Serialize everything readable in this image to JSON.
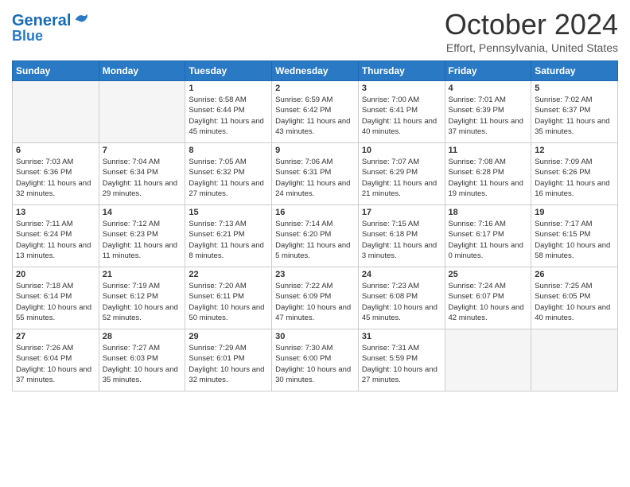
{
  "header": {
    "logo_line1": "General",
    "logo_line2": "Blue",
    "month": "October 2024",
    "location": "Effort, Pennsylvania, United States"
  },
  "days_of_week": [
    "Sunday",
    "Monday",
    "Tuesday",
    "Wednesday",
    "Thursday",
    "Friday",
    "Saturday"
  ],
  "weeks": [
    [
      {
        "day": "",
        "info": "",
        "empty": true
      },
      {
        "day": "",
        "info": "",
        "empty": true
      },
      {
        "day": "1",
        "info": "Sunrise: 6:58 AM\nSunset: 6:44 PM\nDaylight: 11 hours and 45 minutes."
      },
      {
        "day": "2",
        "info": "Sunrise: 6:59 AM\nSunset: 6:42 PM\nDaylight: 11 hours and 43 minutes."
      },
      {
        "day": "3",
        "info": "Sunrise: 7:00 AM\nSunset: 6:41 PM\nDaylight: 11 hours and 40 minutes."
      },
      {
        "day": "4",
        "info": "Sunrise: 7:01 AM\nSunset: 6:39 PM\nDaylight: 11 hours and 37 minutes."
      },
      {
        "day": "5",
        "info": "Sunrise: 7:02 AM\nSunset: 6:37 PM\nDaylight: 11 hours and 35 minutes."
      }
    ],
    [
      {
        "day": "6",
        "info": "Sunrise: 7:03 AM\nSunset: 6:36 PM\nDaylight: 11 hours and 32 minutes."
      },
      {
        "day": "7",
        "info": "Sunrise: 7:04 AM\nSunset: 6:34 PM\nDaylight: 11 hours and 29 minutes."
      },
      {
        "day": "8",
        "info": "Sunrise: 7:05 AM\nSunset: 6:32 PM\nDaylight: 11 hours and 27 minutes."
      },
      {
        "day": "9",
        "info": "Sunrise: 7:06 AM\nSunset: 6:31 PM\nDaylight: 11 hours and 24 minutes."
      },
      {
        "day": "10",
        "info": "Sunrise: 7:07 AM\nSunset: 6:29 PM\nDaylight: 11 hours and 21 minutes."
      },
      {
        "day": "11",
        "info": "Sunrise: 7:08 AM\nSunset: 6:28 PM\nDaylight: 11 hours and 19 minutes."
      },
      {
        "day": "12",
        "info": "Sunrise: 7:09 AM\nSunset: 6:26 PM\nDaylight: 11 hours and 16 minutes."
      }
    ],
    [
      {
        "day": "13",
        "info": "Sunrise: 7:11 AM\nSunset: 6:24 PM\nDaylight: 11 hours and 13 minutes."
      },
      {
        "day": "14",
        "info": "Sunrise: 7:12 AM\nSunset: 6:23 PM\nDaylight: 11 hours and 11 minutes."
      },
      {
        "day": "15",
        "info": "Sunrise: 7:13 AM\nSunset: 6:21 PM\nDaylight: 11 hours and 8 minutes."
      },
      {
        "day": "16",
        "info": "Sunrise: 7:14 AM\nSunset: 6:20 PM\nDaylight: 11 hours and 5 minutes."
      },
      {
        "day": "17",
        "info": "Sunrise: 7:15 AM\nSunset: 6:18 PM\nDaylight: 11 hours and 3 minutes."
      },
      {
        "day": "18",
        "info": "Sunrise: 7:16 AM\nSunset: 6:17 PM\nDaylight: 11 hours and 0 minutes."
      },
      {
        "day": "19",
        "info": "Sunrise: 7:17 AM\nSunset: 6:15 PM\nDaylight: 10 hours and 58 minutes."
      }
    ],
    [
      {
        "day": "20",
        "info": "Sunrise: 7:18 AM\nSunset: 6:14 PM\nDaylight: 10 hours and 55 minutes."
      },
      {
        "day": "21",
        "info": "Sunrise: 7:19 AM\nSunset: 6:12 PM\nDaylight: 10 hours and 52 minutes."
      },
      {
        "day": "22",
        "info": "Sunrise: 7:20 AM\nSunset: 6:11 PM\nDaylight: 10 hours and 50 minutes."
      },
      {
        "day": "23",
        "info": "Sunrise: 7:22 AM\nSunset: 6:09 PM\nDaylight: 10 hours and 47 minutes."
      },
      {
        "day": "24",
        "info": "Sunrise: 7:23 AM\nSunset: 6:08 PM\nDaylight: 10 hours and 45 minutes."
      },
      {
        "day": "25",
        "info": "Sunrise: 7:24 AM\nSunset: 6:07 PM\nDaylight: 10 hours and 42 minutes."
      },
      {
        "day": "26",
        "info": "Sunrise: 7:25 AM\nSunset: 6:05 PM\nDaylight: 10 hours and 40 minutes."
      }
    ],
    [
      {
        "day": "27",
        "info": "Sunrise: 7:26 AM\nSunset: 6:04 PM\nDaylight: 10 hours and 37 minutes."
      },
      {
        "day": "28",
        "info": "Sunrise: 7:27 AM\nSunset: 6:03 PM\nDaylight: 10 hours and 35 minutes."
      },
      {
        "day": "29",
        "info": "Sunrise: 7:29 AM\nSunset: 6:01 PM\nDaylight: 10 hours and 32 minutes."
      },
      {
        "day": "30",
        "info": "Sunrise: 7:30 AM\nSunset: 6:00 PM\nDaylight: 10 hours and 30 minutes."
      },
      {
        "day": "31",
        "info": "Sunrise: 7:31 AM\nSunset: 5:59 PM\nDaylight: 10 hours and 27 minutes."
      },
      {
        "day": "",
        "info": "",
        "empty": true
      },
      {
        "day": "",
        "info": "",
        "empty": true
      }
    ]
  ]
}
